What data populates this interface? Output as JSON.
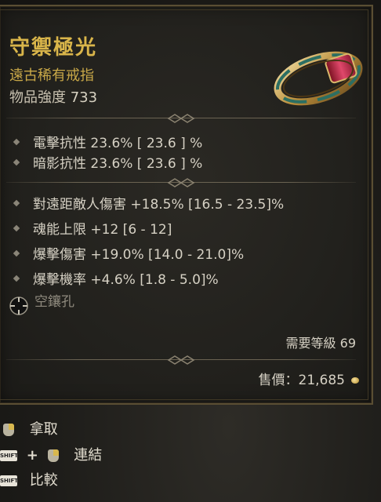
{
  "item": {
    "name": "守禦極光",
    "type": "遠古稀有戒指",
    "power_label": "物品強度",
    "power_value": "733"
  },
  "implicit_stats": [
    "電擊抗性 23.6%  [ 23.6 ] %",
    "暗影抗性 23.6%  [ 23.6 ] %"
  ],
  "affix_stats": [
    "對遠距敵人傷害 +18.5% [16.5 - 23.5]%",
    "魂能上限 +12 [6 - 12]",
    "爆擊傷害 +19.0% [14.0 - 21.0]%",
    "爆擊機率 +4.6% [1.8 - 5.0]%"
  ],
  "socket": {
    "label": "空鑲孔"
  },
  "requirement": "需要等級 69",
  "price": "售價：21,685",
  "actions": [
    {
      "key": "",
      "label": "拿取"
    },
    {
      "key": "SHIFT",
      "label": "連結"
    },
    {
      "key": "SHIFT",
      "label": "比較"
    }
  ],
  "colors": {
    "name": "#d9b54a",
    "type": "#c9a848",
    "stat_text": "#d6d1c4",
    "socket_text": "#8f8a7e"
  }
}
